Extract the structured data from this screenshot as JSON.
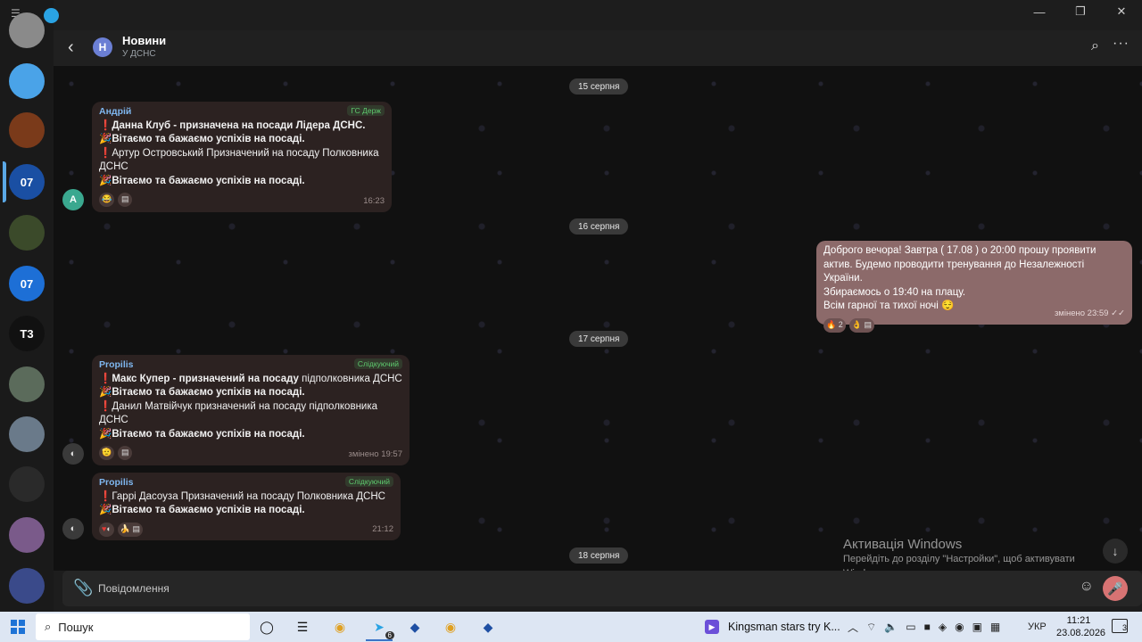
{
  "chat": {
    "title": "Новини",
    "subtitle": "У ДСНС"
  },
  "sidebar": {
    "items": [
      {
        "name": "profile",
        "color": "#8a8a8a",
        "label": ""
      },
      {
        "name": "saved-messages",
        "color": "#4aa3e8",
        "label": ""
      },
      {
        "name": "dsns-emblem",
        "color": "#7a3a1a",
        "label": ""
      },
      {
        "name": "dsns-07",
        "color": "#1a4fa3",
        "label": "07"
      },
      {
        "name": "chat-5",
        "color": "#3b4a2a",
        "label": ""
      },
      {
        "name": "chat-07-leaders",
        "color": "#1d6fd6",
        "label": "07"
      },
      {
        "name": "t3",
        "color": "#111111",
        "label": "T3"
      },
      {
        "name": "chat-8",
        "color": "#5b6b5b",
        "label": ""
      },
      {
        "name": "chat-9",
        "color": "#6a7a8a",
        "label": ""
      },
      {
        "name": "chat-10",
        "color": "#2a2a2a",
        "label": ""
      },
      {
        "name": "chat-11",
        "color": "#7a5a8a",
        "label": ""
      },
      {
        "name": "chat-12",
        "color": "#3a4a8a",
        "label": ""
      }
    ]
  },
  "dates": [
    "15 серпня",
    "16 серпня",
    "17 серпня",
    "18 серпня"
  ],
  "messages": [
    {
      "author": "Андрій",
      "role": "ГС Держ",
      "time": "16:23",
      "edited": "",
      "avatar_letter": "А",
      "lines": [
        "Данна Клуб  - призначена на посади  Лідера ДСНС.",
        "Вітаємо та бажаємо успіхів на посаді.",
        "Артур Островський Призначений на посаду Полковника",
        "ДСНС",
        "Вітаємо та бажаємо успіхів на посаді."
      ]
    },
    {
      "author": "",
      "role": "",
      "time": "23:59",
      "edited": "змінено",
      "reaction_count": "2",
      "lines": [
        "Доброго вечора!  Завтра ( 17.08 ) о 20:00 прошу проявити",
        "актив. Будемо проводити тренування до Незалежності України.",
        "Збираємось о 19:40 на плацу.",
        "Всім гарної та тихої ночі"
      ]
    },
    {
      "author": "Propilis",
      "role": "Слідкуючий",
      "time": "19:57",
      "edited": "змінено",
      "lines_bold": "Макс Купер - призначений на посаду",
      "lines_rest": "підполковника ДСНС",
      "lines": [
        "Вітаємо та бажаємо успіхів на посаді.",
        "Данил Матвійчук призначений на посаду підполковника",
        "ДСНС",
        "Вітаємо та бажаємо успіхів на посаді."
      ]
    },
    {
      "author": "Propilis",
      "role": "Слідкуючий",
      "time": "21:12",
      "edited": "",
      "lines": [
        "Гаррі  Дасоуза Призначений на посаду Полковника  ДСНС",
        "Вітаємо та бажаємо успіхів на посаді."
      ]
    }
  ],
  "composer": {
    "placeholder": "Повідомлення"
  },
  "activation": {
    "title": "Активація Windows",
    "text": "Перейдіть до розділу \"Настройки\", щоб активувати Windows."
  },
  "taskbar": {
    "search_label": "Пошук",
    "telegram_badge": "6",
    "media_title": "Kingsman stars try K...",
    "lang": "УКР",
    "time": "11:21",
    "date": "23.08.2026",
    "notifications": "3"
  },
  "colors": {
    "own_bubble": "#8c6a6a",
    "bubble": "#2c2221",
    "accent": "#5aa8e6",
    "role_green": "#5ec96e"
  }
}
